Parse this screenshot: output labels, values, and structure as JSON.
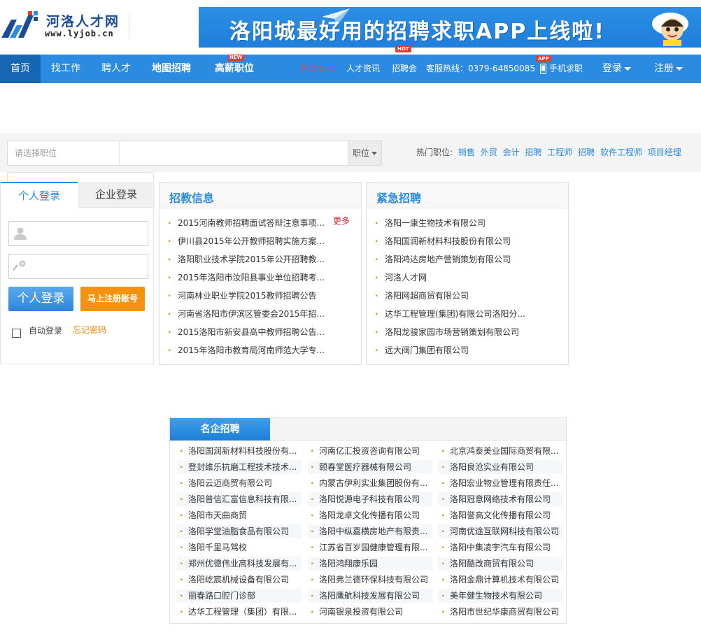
{
  "header": {
    "logo_title": "河洛人才网",
    "logo_url": "www.lyjob.cn",
    "banner_text": "洛阳城最好用的招聘求职APP上线啦!"
  },
  "nav": {
    "items": [
      {
        "label": "首页"
      },
      {
        "label": "找工作"
      },
      {
        "label": "聘人才"
      },
      {
        "label": "地图招聘"
      },
      {
        "label": "高薪职位",
        "badge": "NEW"
      }
    ],
    "right_items": [
      {
        "label": "外出务工",
        "badge": "HOT"
      },
      {
        "label": "人才资讯"
      },
      {
        "label": "招聘会"
      },
      {
        "label": "客服热线：0379-64850085"
      },
      {
        "label": "手机求职",
        "badge": "APP"
      }
    ],
    "login_label": "登录",
    "register_label": "注册"
  },
  "search": {
    "placeholder": "请选择职位",
    "type_label": "职位",
    "hot_label": "热门职位:",
    "hot_links": [
      "销售",
      "外贸",
      "会计",
      "招聘",
      "工程师",
      "招聘",
      "软件工程师",
      "项目经理"
    ]
  },
  "login": {
    "tab_personal": "个人登录",
    "tab_company": "企业登录",
    "login_button": "个人登录",
    "register_button": "马上注册账号",
    "auto_login": "自动登录",
    "forgot_password": "忘记密码"
  },
  "teacher": {
    "title": "招教信息",
    "more": "更多",
    "items": [
      "2015河南教师招聘面试答辩注意事项...",
      "伊川县2015年公开教师招聘实施方案...",
      "洛阳职业技术学院2015年公开招聘教...",
      "2015年洛阳市汝阳县事业单位招聘考...",
      "河南林业职业学院2015教师招聘公告",
      "河南省洛阳市伊滨区管委会2015年招...",
      "2015洛阳市新安县高中教师招聘公告...",
      "2015年洛阳市教育局河南师范大学专..."
    ]
  },
  "urgent": {
    "title": "紧急招聘",
    "items": [
      "洛阳一康生物技术有限公司",
      "洛阳国润新材料科技股份有限公司",
      "洛阳鸿达房地产营销策划有限公司",
      "河洛人才网",
      "洛阳网超商贸有限公司",
      "达华工程管理(集团)有限公司洛阳分...",
      "洛阳龙骏家园市场营销策划有限公司",
      "远大阀门集团有限公司"
    ]
  },
  "famous": {
    "title": "名企招聘",
    "items": [
      "洛阳国润新材料科技股份有...",
      "河南亿汇投资咨询有限公司",
      "北京鸿泰美业国际商贸有限...",
      "登封维乐抗磨工程技术技术...",
      "颐春堂医疗器械有限公司",
      "洛阳良沧实业有限公司",
      "洛阳云迈商贸有限公司",
      "内蒙古伊利实业集团股份有...",
      "洛阳宏业物业管理有限责任...",
      "洛阳普信汇富信息科技有限...",
      "洛阳悦源电子科技有限公司",
      "洛阳冠意网络技术有限公司",
      "洛阳市天曲商贸",
      "洛阳龙卓文化传播有限公司",
      "洛阳誉高文化传播有限公司",
      "洛阳学堂油脂食品有限公司",
      "洛阳中纵嘉横房地产有限责...",
      "河南优途互联网科技有限公司",
      "洛阳千里马驾校",
      "江苏省百岁园健康管理有限...",
      "洛阳中集凌宇汽车有限公司",
      "郑州优德伟业高科技发展有...",
      "洛阳鸿翔康乐园",
      "洛阳酷改商贸有限公司",
      "洛阳屹宸机械设备有限公司",
      "洛阳弗兰德环保科技有限公司",
      "洛阳金鼎计算机技术有限公司",
      "丽春路口腔门诊部",
      "洛阳鹰航科技发展有限公司",
      "美年健生物技术有限公司",
      "达华工程管理（集团）有限...",
      "河南银泉投资有限公司",
      "洛阳市世纪华康商贸有限公司"
    ]
  },
  "colors": {
    "primary": "#2a8be0",
    "nav_active": "#1766b3",
    "accent_orange": "#f59311",
    "hot_red": "#ff3b3b"
  }
}
